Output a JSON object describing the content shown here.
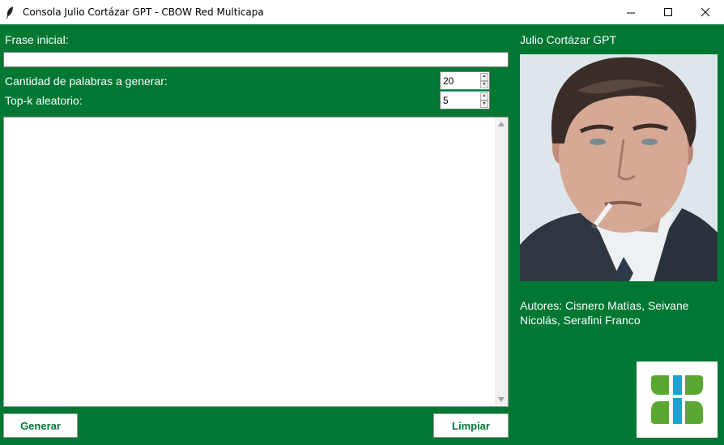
{
  "window": {
    "title": "Consola Julio Cortázar GPT - CBOW Red Multicapa",
    "minimize_icon": "minimize-icon",
    "maximize_icon": "maximize-icon",
    "close_icon": "close-icon"
  },
  "form": {
    "initial_phrase_label": "Frase inicial:",
    "initial_phrase_value": "",
    "word_count_label": "Cantidad de palabras a generar:",
    "word_count_value": "20",
    "topk_label": "Top-k aleatorio:",
    "topk_value": "5",
    "output_text": ""
  },
  "buttons": {
    "generate": "Generar",
    "clear": "Limpiar"
  },
  "sidebar": {
    "title": "Julio Cortázar GPT",
    "authors": "Autores: Cisnero Matías, Seivane Nicolás, Serafini Franco"
  },
  "colors": {
    "background": "#007733",
    "text": "#ffffff",
    "button_text": "#007733",
    "logo_green": "#5aa832",
    "logo_blue": "#1da1d4"
  }
}
